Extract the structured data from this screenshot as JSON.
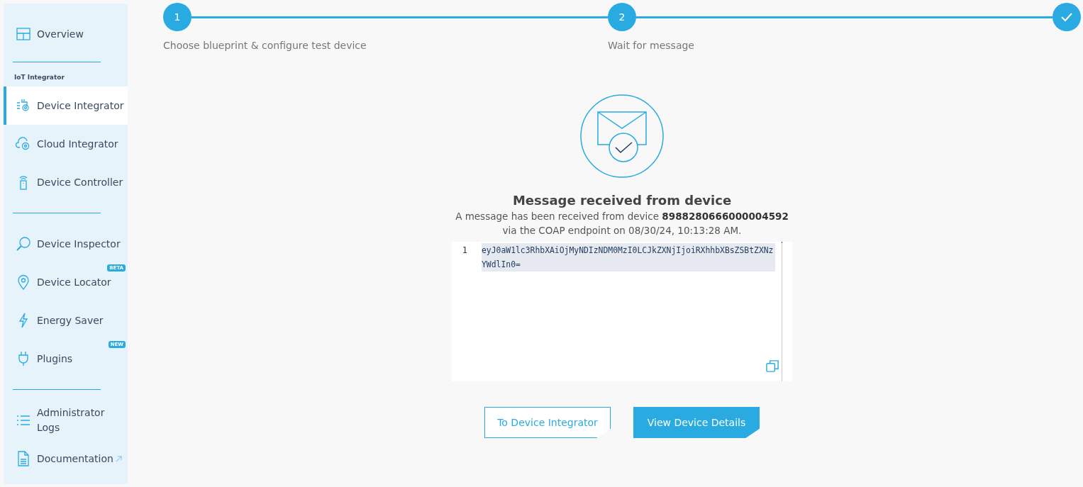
{
  "sidebar": {
    "items": [
      {
        "kind": "item",
        "label": "Overview",
        "selected": false
      },
      {
        "kind": "divider"
      },
      {
        "kind": "section",
        "label": "IoT Integrator"
      },
      {
        "kind": "item",
        "label": "Device Integrator",
        "selected": true
      },
      {
        "kind": "item",
        "label": "Cloud Integrator",
        "selected": false
      },
      {
        "kind": "item",
        "label": "Device Controller",
        "selected": false
      },
      {
        "kind": "divider"
      },
      {
        "kind": "item",
        "label": "Device Inspector",
        "selected": false
      },
      {
        "kind": "item",
        "label": "Device Locator",
        "selected": false,
        "badge": "BETA"
      },
      {
        "kind": "item",
        "label": "Energy Saver",
        "selected": false
      },
      {
        "kind": "item",
        "label": "Plugins",
        "selected": false,
        "badge": "NEW"
      },
      {
        "kind": "divider"
      },
      {
        "kind": "item",
        "label": "Administrator Logs",
        "selected": false
      },
      {
        "kind": "item",
        "label": "Documentation",
        "selected": false,
        "external": true
      }
    ]
  },
  "stepper": {
    "steps": [
      {
        "kind": "number",
        "number": "1",
        "label": "Choose blueprint & configure test device"
      },
      {
        "kind": "number",
        "number": "2",
        "label": "Wait for message"
      },
      {
        "kind": "done"
      }
    ]
  },
  "result": {
    "title": "Message received from device",
    "message": "A message has been received from device **8988280666000004592**",
    "message_line_2": "via the COAP endpoint on 08/30/24, 10:13:28 AM.",
    "code": {
      "lines": [
        {
          "number": "1",
          "text": "eyJ0aW1lc3RhbXAiOjMyNDIzNDM0MzI0LCJkZXNjIjoiRXhhbXBsZSBtZXNzYWdlIn0=",
          "selected": true
        }
      ]
    }
  },
  "buttons": [
    {
      "kind": "secondary",
      "label": "To Device Integrator"
    },
    {
      "kind": "primary",
      "label": "View Device Details"
    }
  ]
}
